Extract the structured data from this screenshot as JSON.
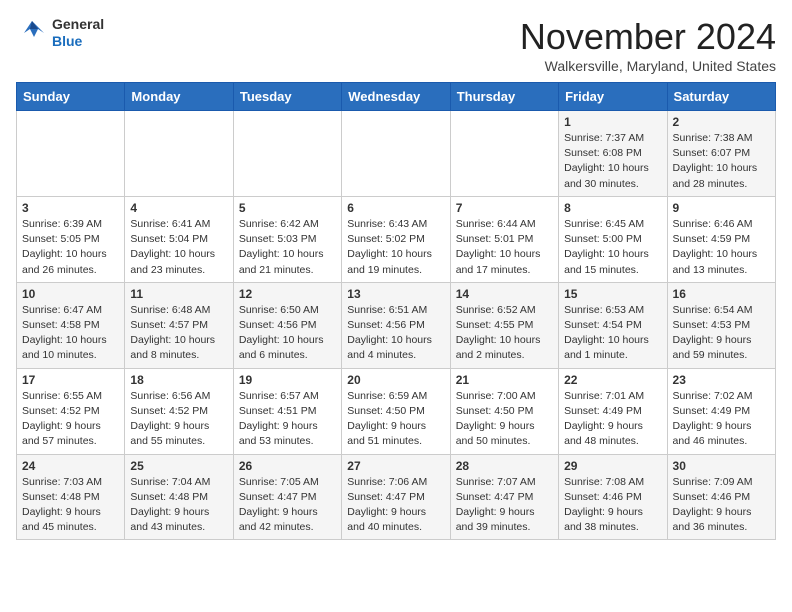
{
  "header": {
    "logo_line1": "General",
    "logo_line2": "Blue",
    "month": "November 2024",
    "location": "Walkersville, Maryland, United States"
  },
  "days_of_week": [
    "Sunday",
    "Monday",
    "Tuesday",
    "Wednesday",
    "Thursday",
    "Friday",
    "Saturday"
  ],
  "weeks": [
    [
      {
        "day": "",
        "info": ""
      },
      {
        "day": "",
        "info": ""
      },
      {
        "day": "",
        "info": ""
      },
      {
        "day": "",
        "info": ""
      },
      {
        "day": "",
        "info": ""
      },
      {
        "day": "1",
        "info": "Sunrise: 7:37 AM\nSunset: 6:08 PM\nDaylight: 10 hours and 30 minutes."
      },
      {
        "day": "2",
        "info": "Sunrise: 7:38 AM\nSunset: 6:07 PM\nDaylight: 10 hours and 28 minutes."
      }
    ],
    [
      {
        "day": "3",
        "info": "Sunrise: 6:39 AM\nSunset: 5:05 PM\nDaylight: 10 hours and 26 minutes."
      },
      {
        "day": "4",
        "info": "Sunrise: 6:41 AM\nSunset: 5:04 PM\nDaylight: 10 hours and 23 minutes."
      },
      {
        "day": "5",
        "info": "Sunrise: 6:42 AM\nSunset: 5:03 PM\nDaylight: 10 hours and 21 minutes."
      },
      {
        "day": "6",
        "info": "Sunrise: 6:43 AM\nSunset: 5:02 PM\nDaylight: 10 hours and 19 minutes."
      },
      {
        "day": "7",
        "info": "Sunrise: 6:44 AM\nSunset: 5:01 PM\nDaylight: 10 hours and 17 minutes."
      },
      {
        "day": "8",
        "info": "Sunrise: 6:45 AM\nSunset: 5:00 PM\nDaylight: 10 hours and 15 minutes."
      },
      {
        "day": "9",
        "info": "Sunrise: 6:46 AM\nSunset: 4:59 PM\nDaylight: 10 hours and 13 minutes."
      }
    ],
    [
      {
        "day": "10",
        "info": "Sunrise: 6:47 AM\nSunset: 4:58 PM\nDaylight: 10 hours and 10 minutes."
      },
      {
        "day": "11",
        "info": "Sunrise: 6:48 AM\nSunset: 4:57 PM\nDaylight: 10 hours and 8 minutes."
      },
      {
        "day": "12",
        "info": "Sunrise: 6:50 AM\nSunset: 4:56 PM\nDaylight: 10 hours and 6 minutes."
      },
      {
        "day": "13",
        "info": "Sunrise: 6:51 AM\nSunset: 4:56 PM\nDaylight: 10 hours and 4 minutes."
      },
      {
        "day": "14",
        "info": "Sunrise: 6:52 AM\nSunset: 4:55 PM\nDaylight: 10 hours and 2 minutes."
      },
      {
        "day": "15",
        "info": "Sunrise: 6:53 AM\nSunset: 4:54 PM\nDaylight: 10 hours and 1 minute."
      },
      {
        "day": "16",
        "info": "Sunrise: 6:54 AM\nSunset: 4:53 PM\nDaylight: 9 hours and 59 minutes."
      }
    ],
    [
      {
        "day": "17",
        "info": "Sunrise: 6:55 AM\nSunset: 4:52 PM\nDaylight: 9 hours and 57 minutes."
      },
      {
        "day": "18",
        "info": "Sunrise: 6:56 AM\nSunset: 4:52 PM\nDaylight: 9 hours and 55 minutes."
      },
      {
        "day": "19",
        "info": "Sunrise: 6:57 AM\nSunset: 4:51 PM\nDaylight: 9 hours and 53 minutes."
      },
      {
        "day": "20",
        "info": "Sunrise: 6:59 AM\nSunset: 4:50 PM\nDaylight: 9 hours and 51 minutes."
      },
      {
        "day": "21",
        "info": "Sunrise: 7:00 AM\nSunset: 4:50 PM\nDaylight: 9 hours and 50 minutes."
      },
      {
        "day": "22",
        "info": "Sunrise: 7:01 AM\nSunset: 4:49 PM\nDaylight: 9 hours and 48 minutes."
      },
      {
        "day": "23",
        "info": "Sunrise: 7:02 AM\nSunset: 4:49 PM\nDaylight: 9 hours and 46 minutes."
      }
    ],
    [
      {
        "day": "24",
        "info": "Sunrise: 7:03 AM\nSunset: 4:48 PM\nDaylight: 9 hours and 45 minutes."
      },
      {
        "day": "25",
        "info": "Sunrise: 7:04 AM\nSunset: 4:48 PM\nDaylight: 9 hours and 43 minutes."
      },
      {
        "day": "26",
        "info": "Sunrise: 7:05 AM\nSunset: 4:47 PM\nDaylight: 9 hours and 42 minutes."
      },
      {
        "day": "27",
        "info": "Sunrise: 7:06 AM\nSunset: 4:47 PM\nDaylight: 9 hours and 40 minutes."
      },
      {
        "day": "28",
        "info": "Sunrise: 7:07 AM\nSunset: 4:47 PM\nDaylight: 9 hours and 39 minutes."
      },
      {
        "day": "29",
        "info": "Sunrise: 7:08 AM\nSunset: 4:46 PM\nDaylight: 9 hours and 38 minutes."
      },
      {
        "day": "30",
        "info": "Sunrise: 7:09 AM\nSunset: 4:46 PM\nDaylight: 9 hours and 36 minutes."
      }
    ]
  ]
}
